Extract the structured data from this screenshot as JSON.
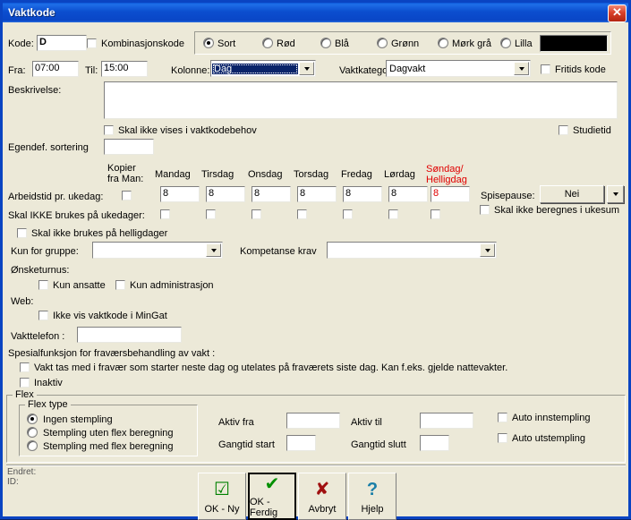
{
  "window": {
    "title": "Vaktkode",
    "close_label": "✕"
  },
  "top": {
    "kode_label": "Kode:",
    "kode_value": "D",
    "kombinasjonskode_label": "Kombinasjonskode",
    "fra_label": "Fra:",
    "fra_value": "07:00",
    "til_label": "Til:",
    "til_value": "15:00",
    "kolonne_label": "Kolonne:",
    "kolonne_value": "Dag",
    "vaktkategori_label": "Vaktkategori:",
    "vaktkategori_value": "Dagvakt",
    "fritids_kode_label": "Fritids kode"
  },
  "colors": {
    "swatch_hex": "#000000",
    "options": [
      {
        "label": "Sort",
        "selected": true
      },
      {
        "label": "Rød",
        "selected": false
      },
      {
        "label": "Blå",
        "selected": false
      },
      {
        "label": "Grønn",
        "selected": false
      },
      {
        "label": "Mørk grå",
        "selected": false
      },
      {
        "label": "Lilla",
        "selected": false
      }
    ]
  },
  "description": {
    "label": "Beskrivelse:",
    "value": "",
    "skal_ikke_vises_label": "Skal ikke vises i vaktkodebehov",
    "studietid_label": "Studietid",
    "egendef_sortering_label": "Egendef. sortering",
    "egendef_sortering_value": ""
  },
  "weekdays": {
    "kopier_label_line1": "Kopier",
    "kopier_label_line2": "fra Man:",
    "arbeidstid_label": "Arbeidstid pr. ukedag:",
    "skal_ikke_ukedager_label": "Skal IKKE brukes på ukedager:",
    "skal_ikke_helligdager_label": "Skal ikke brukes på helligdager",
    "skal_ikke_ukesum_label": "Skal ikke beregnes i ukesum",
    "spisepause_label": "Spisepause:",
    "spisepause_value": "Nei",
    "days": [
      {
        "name": "Mandag",
        "name2": "",
        "hours": "8",
        "red": false
      },
      {
        "name": "Tirsdag",
        "name2": "",
        "hours": "8",
        "red": false
      },
      {
        "name": "Onsdag",
        "name2": "",
        "hours": "8",
        "red": false
      },
      {
        "name": "Torsdag",
        "name2": "",
        "hours": "8",
        "red": false
      },
      {
        "name": "Fredag",
        "name2": "",
        "hours": "8",
        "red": false
      },
      {
        "name": "Lørdag",
        "name2": "",
        "hours": "8",
        "red": false
      },
      {
        "name": "Søndag/",
        "name2": "Helligdag",
        "hours": "8",
        "red": true
      }
    ]
  },
  "groups": {
    "kun_for_gruppe_label": "Kun for gruppe:",
    "kun_for_gruppe_value": "",
    "kompetanse_krav_label": "Kompetanse krav",
    "kompetanse_krav_value": "",
    "onsketurnus_label": "Ønsketurnus:",
    "kun_ansatte_label": "Kun ansatte",
    "kun_administrasjon_label": "Kun administrasjon",
    "web_label": "Web:",
    "ikke_vis_mingat_label": "Ikke vis vaktkode i MinGat",
    "vakttelefon_label": "Vakttelefon :",
    "vakttelefon_value": "",
    "spesialfunksjon_label": "Spesialfunksjon  for fraværsbehandling av vakt :",
    "vakt_tas_med_label": "Vakt tas med i fravær som starter neste dag og utelates på fraværets siste dag. Kan f.eks. gjelde nattevakter.",
    "inaktiv_label": "Inaktiv"
  },
  "flex": {
    "caption": "Flex",
    "type_caption": "Flex type",
    "types": [
      {
        "label": "Ingen stempling",
        "selected": true
      },
      {
        "label": "Stempling uten flex beregning",
        "selected": false
      },
      {
        "label": "Stempling med flex beregning",
        "selected": false
      }
    ],
    "aktiv_fra_label": "Aktiv fra",
    "aktiv_fra_value": "",
    "aktiv_til_label": "Aktiv til",
    "aktiv_til_value": "",
    "gangtid_start_label": "Gangtid start",
    "gangtid_start_value": "",
    "gangtid_slutt_label": "Gangtid slutt",
    "gangtid_slutt_value": "",
    "auto_inn_label": "Auto innstempling",
    "auto_ut_label": "Auto utstempling"
  },
  "footer": {
    "endret_label": "Endret:",
    "id_label": "ID:",
    "buttons": [
      {
        "name": "ok-ny",
        "icon": "checkbox-check-icon",
        "glyph": "☑",
        "color": "#008000",
        "label_pre": "",
        "label_accel": "N",
        "label_post": "y",
        "label_full": "OK - Ny",
        "default": false
      },
      {
        "name": "ok-ferdig",
        "icon": "check-icon",
        "glyph": "✔",
        "color": "#009000",
        "label_pre": "",
        "label_accel": "O",
        "label_post": "K - Ferdig",
        "label_full": "OK - Ferdig",
        "default": true
      },
      {
        "name": "avbryt",
        "icon": "cross-icon",
        "glyph": "✘",
        "color": "#a01010",
        "label_pre": "",
        "label_accel": "A",
        "label_post": "vbryt",
        "label_full": "Avbryt",
        "default": false
      },
      {
        "name": "hjelp",
        "icon": "question-mark-icon",
        "glyph": "?",
        "color": "#1a7fa8",
        "label_pre": "",
        "label_accel": "H",
        "label_post": "jelp",
        "label_full": "Hjelp",
        "default": false
      }
    ]
  }
}
